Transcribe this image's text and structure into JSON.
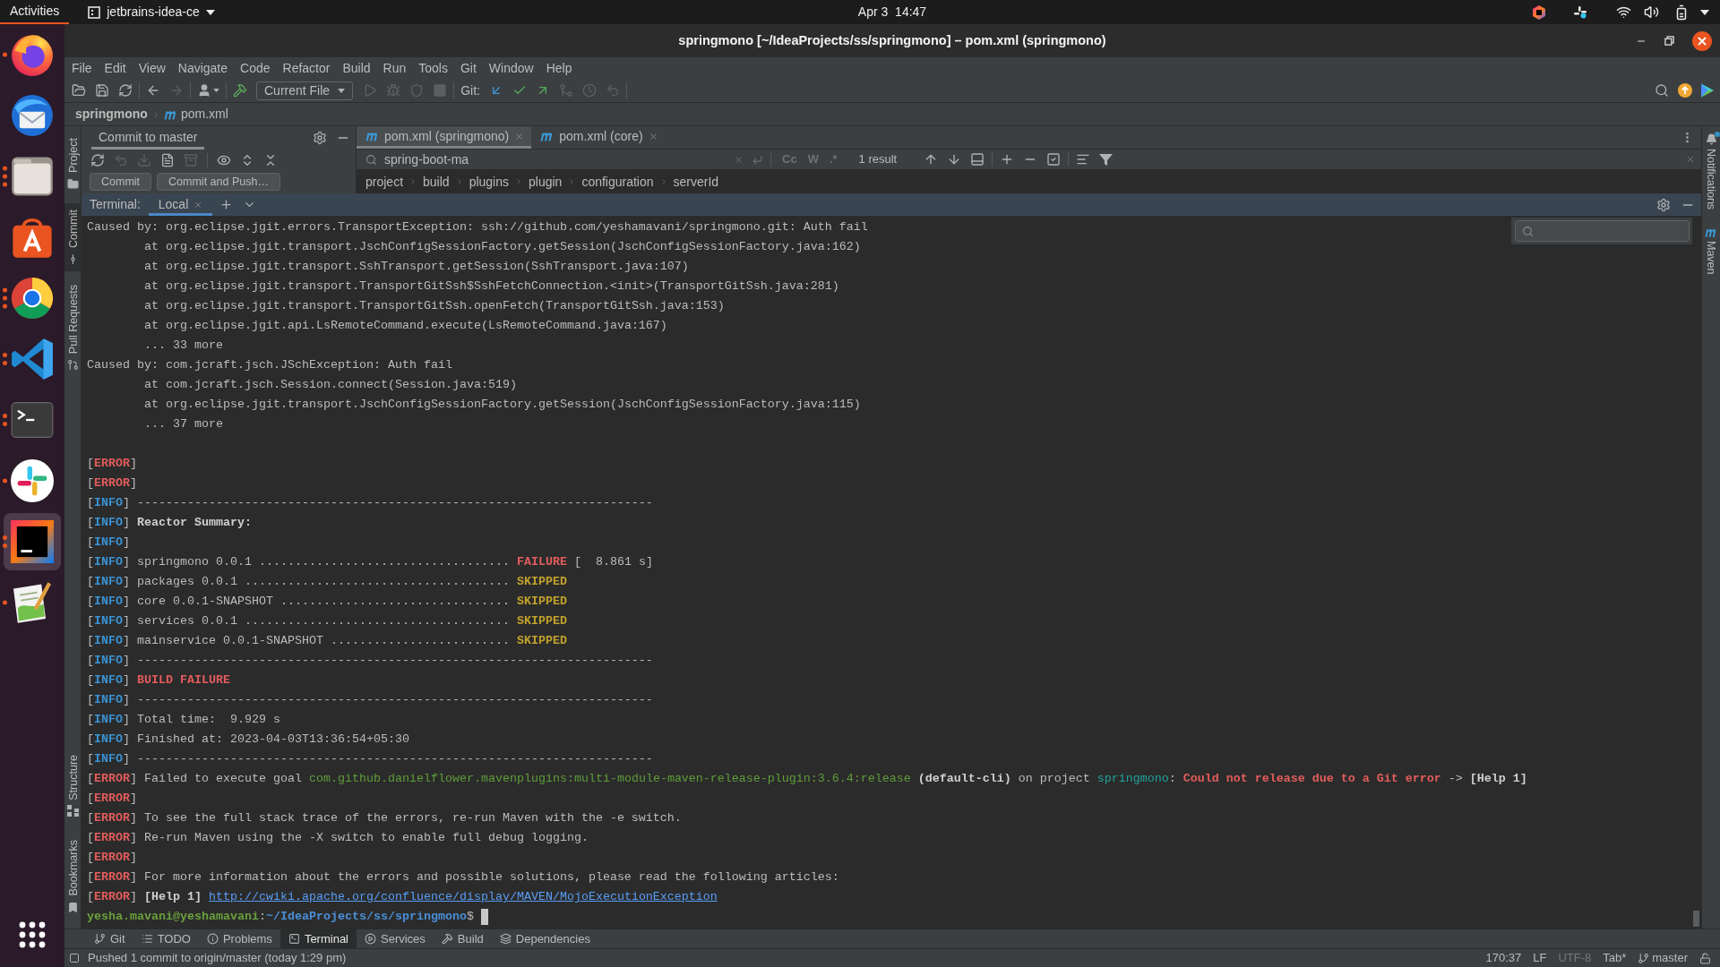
{
  "top_bar": {
    "activities": "Activities",
    "app_menu": "jetbrains-idea-ce",
    "clock": "Apr 3  14:47"
  },
  "dock": [
    {
      "kind": "browser",
      "selected": false,
      "windows": [
        {
          "kind": "dot"
        }
      ]
    },
    {
      "kind": "mail",
      "selected": false
    },
    {
      "kind": "files",
      "selected": false,
      "windows": [
        {
          "kind": "dot"
        },
        {
          "kind": "dot"
        },
        {
          "kind": "dot"
        }
      ]
    },
    {
      "kind": "store",
      "selected": false
    },
    {
      "kind": "web",
      "selected": false,
      "windows": [
        {
          "kind": "dot"
        },
        {
          "kind": "dot"
        },
        {
          "kind": "dot"
        }
      ]
    },
    {
      "kind": "editor",
      "selected": false,
      "windows": [
        {
          "kind": "dot"
        },
        {
          "kind": "dot"
        }
      ]
    },
    {
      "kind": "terminal",
      "selected": false,
      "windows": [
        {
          "kind": "dot"
        },
        {
          "kind": "dot"
        }
      ]
    },
    {
      "kind": "chat",
      "selected": false,
      "windows": [
        {
          "kind": "dot"
        }
      ]
    },
    {
      "kind": "ide",
      "selected": true,
      "windows": [
        {
          "kind": "dot"
        },
        {
          "kind": "dot"
        }
      ]
    },
    {
      "kind": "notepad",
      "selected": false,
      "windows": [
        {
          "kind": "dot"
        }
      ]
    }
  ],
  "window": {
    "title": "springmono [~/IdeaProjects/ss/springmono] – pom.xml (springmono)"
  },
  "menu": [
    "File",
    "Edit",
    "View",
    "Navigate",
    "Code",
    "Refactor",
    "Build",
    "Run",
    "Tools",
    "Git",
    "Window",
    "Help"
  ],
  "toolbar": {
    "nav_buttons": [
      {
        "disabled": false
      },
      {
        "disabled": true
      }
    ],
    "run_config": "Current File",
    "run_buttons": [
      {
        "disabled": true
      },
      {
        "disabled": true
      },
      {
        "disabled": true
      },
      {
        "disabled": true
      }
    ],
    "git_label": "Git:",
    "git_buttons": [
      {
        "disabled": false
      },
      {
        "disabled": false
      },
      {
        "disabled": false
      },
      {
        "disabled": true
      },
      {
        "disabled": true
      },
      {
        "disabled": true
      }
    ]
  },
  "navbar": {
    "project": "springmono",
    "file": "pom.xml"
  },
  "left_stripe": {
    "top": [
      {
        "kind": "project",
        "label": "Project",
        "selected": false
      },
      {
        "kind": "commit",
        "label": "Commit",
        "selected": true
      },
      {
        "kind": "pull_requests",
        "label": "Pull Requests",
        "selected": false
      }
    ],
    "bottom": [
      {
        "kind": "structure",
        "label": "Structure",
        "selected": false
      },
      {
        "kind": "bookmarks",
        "label": "Bookmarks",
        "selected": false
      }
    ]
  },
  "commit_panel": {
    "tab": "Commit to master",
    "tool_buttons": [
      {
        "disabled": false
      },
      {
        "disabled": true
      },
      {
        "disabled": true
      },
      {
        "disabled": false
      },
      {
        "disabled": true
      },
      {
        "disabled": false
      },
      {
        "disabled": false
      },
      {
        "disabled": false
      }
    ],
    "buttons": [
      "Commit",
      "Commit and Push…"
    ]
  },
  "editor": {
    "tabs": [
      {
        "label": "pom.xml (springmono)",
        "selected": true
      },
      {
        "label": "pom.xml (core)",
        "selected": false
      }
    ],
    "search": {
      "value": "spring-boot-ma",
      "options": [
        {
          "label": "Cc",
          "selected": false
        },
        {
          "label": "W",
          "selected": false
        },
        {
          "label": ".*",
          "selected": false
        }
      ],
      "result": "1 result"
    },
    "breadcrumbs": [
      "project",
      "build",
      "plugins",
      "plugin",
      "configuration",
      "serverId"
    ]
  },
  "terminal": {
    "label": "Terminal:",
    "tabs": [
      {
        "label": "Local",
        "selected": true
      }
    ],
    "lines": [
      {
        "kind": "log",
        "segments": [
          {
            "text": "Caused by: org.eclipse.jgit.errors.TransportException: ssh://github.com/yeshamavani/springmono.git: Auth fail",
            "kind": "plain"
          }
        ]
      },
      {
        "kind": "trace",
        "segments": [
          {
            "text": "at org.eclipse.jgit.transport.JschConfigSessionFactory.getSession(JschConfigSessionFactory.java:162)",
            "kind": "plain"
          }
        ]
      },
      {
        "kind": "trace",
        "segments": [
          {
            "text": "at org.eclipse.jgit.transport.SshTransport.getSession(SshTransport.java:107)",
            "kind": "plain"
          }
        ]
      },
      {
        "kind": "trace",
        "segments": [
          {
            "text": "at org.eclipse.jgit.transport.TransportGitSsh$SshFetchConnection.<init>(TransportGitSsh.java:281)",
            "kind": "plain"
          }
        ]
      },
      {
        "kind": "trace",
        "segments": [
          {
            "text": "at org.eclipse.jgit.transport.TransportGitSsh.openFetch(TransportGitSsh.java:153)",
            "kind": "plain"
          }
        ]
      },
      {
        "kind": "trace",
        "segments": [
          {
            "text": "at org.eclipse.jgit.api.LsRemoteCommand.execute(LsRemoteCommand.java:167)",
            "kind": "plain"
          }
        ]
      },
      {
        "kind": "trace",
        "segments": [
          {
            "text": "... 33 more",
            "kind": "plain"
          }
        ]
      },
      {
        "kind": "log",
        "segments": [
          {
            "text": "Caused by: com.jcraft.jsch.JSchException: Auth fail",
            "kind": "plain"
          }
        ]
      },
      {
        "kind": "trace",
        "segments": [
          {
            "text": "at com.jcraft.jsch.Session.connect(Session.java:519)",
            "kind": "plain"
          }
        ]
      },
      {
        "kind": "trace",
        "segments": [
          {
            "text": "at org.eclipse.jgit.transport.JschConfigSessionFactory.getSession(JschConfigSessionFactory.java:115)",
            "kind": "plain"
          }
        ]
      },
      {
        "kind": "trace",
        "segments": [
          {
            "text": "... 37 more",
            "kind": "plain"
          }
        ]
      },
      {
        "kind": "blank"
      },
      {
        "kind": "log",
        "segments": [
          {
            "text": "[",
            "kind": "plain"
          },
          {
            "text": "ERROR",
            "kind": "error"
          },
          {
            "text": "]",
            "kind": "plain"
          }
        ]
      },
      {
        "kind": "log",
        "segments": [
          {
            "text": "[",
            "kind": "plain"
          },
          {
            "text": "ERROR",
            "kind": "error"
          },
          {
            "text": "]",
            "kind": "plain"
          }
        ]
      },
      {
        "kind": "log",
        "segments": [
          {
            "text": "[",
            "kind": "plain"
          },
          {
            "text": "INFO",
            "kind": "info"
          },
          {
            "text": "] ------------------------------------------------------------------------",
            "kind": "plain"
          }
        ]
      },
      {
        "kind": "log",
        "segments": [
          {
            "text": "[",
            "kind": "plain"
          },
          {
            "text": "INFO",
            "kind": "info"
          },
          {
            "text": "] ",
            "kind": "plain"
          },
          {
            "text": "Reactor Summary:",
            "kind": "bold"
          }
        ]
      },
      {
        "kind": "log",
        "segments": [
          {
            "text": "[",
            "kind": "plain"
          },
          {
            "text": "INFO",
            "kind": "info"
          },
          {
            "text": "]",
            "kind": "plain"
          }
        ]
      },
      {
        "kind": "log",
        "segments": [
          {
            "text": "[",
            "kind": "plain"
          },
          {
            "text": "INFO",
            "kind": "info"
          },
          {
            "text": "] springmono 0.0.1 ................................... ",
            "kind": "plain"
          },
          {
            "text": "FAILURE",
            "kind": "error"
          },
          {
            "text": " [  8.861 s]",
            "kind": "plain"
          }
        ]
      },
      {
        "kind": "log",
        "segments": [
          {
            "text": "[",
            "kind": "plain"
          },
          {
            "text": "INFO",
            "kind": "info"
          },
          {
            "text": "] packages 0.0.1 ..................................... ",
            "kind": "plain"
          },
          {
            "text": "SKIPPED",
            "kind": "skipped"
          }
        ]
      },
      {
        "kind": "log",
        "segments": [
          {
            "text": "[",
            "kind": "plain"
          },
          {
            "text": "INFO",
            "kind": "info"
          },
          {
            "text": "] core 0.0.1-SNAPSHOT ................................ ",
            "kind": "plain"
          },
          {
            "text": "SKIPPED",
            "kind": "skipped"
          }
        ]
      },
      {
        "kind": "log",
        "segments": [
          {
            "text": "[",
            "kind": "plain"
          },
          {
            "text": "INFO",
            "kind": "info"
          },
          {
            "text": "] services 0.0.1 ..................................... ",
            "kind": "plain"
          },
          {
            "text": "SKIPPED",
            "kind": "skipped"
          }
        ]
      },
      {
        "kind": "log",
        "segments": [
          {
            "text": "[",
            "kind": "plain"
          },
          {
            "text": "INFO",
            "kind": "info"
          },
          {
            "text": "] mainservice 0.0.1-SNAPSHOT ......................... ",
            "kind": "plain"
          },
          {
            "text": "SKIPPED",
            "kind": "skipped"
          }
        ]
      },
      {
        "kind": "log",
        "segments": [
          {
            "text": "[",
            "kind": "plain"
          },
          {
            "text": "INFO",
            "kind": "info"
          },
          {
            "text": "] ------------------------------------------------------------------------",
            "kind": "plain"
          }
        ]
      },
      {
        "kind": "log",
        "segments": [
          {
            "text": "[",
            "kind": "plain"
          },
          {
            "text": "INFO",
            "kind": "info"
          },
          {
            "text": "] ",
            "kind": "plain"
          },
          {
            "text": "BUILD FAILURE",
            "kind": "error"
          }
        ]
      },
      {
        "kind": "log",
        "segments": [
          {
            "text": "[",
            "kind": "plain"
          },
          {
            "text": "INFO",
            "kind": "info"
          },
          {
            "text": "] ------------------------------------------------------------------------",
            "kind": "plain"
          }
        ]
      },
      {
        "kind": "log",
        "segments": [
          {
            "text": "[",
            "kind": "plain"
          },
          {
            "text": "INFO",
            "kind": "info"
          },
          {
            "text": "] Total time:  9.929 s",
            "kind": "plain"
          }
        ]
      },
      {
        "kind": "log",
        "segments": [
          {
            "text": "[",
            "kind": "plain"
          },
          {
            "text": "INFO",
            "kind": "info"
          },
          {
            "text": "] Finished at: 2023-04-03T13:36:54+05:30",
            "kind": "plain"
          }
        ]
      },
      {
        "kind": "log",
        "segments": [
          {
            "text": "[",
            "kind": "plain"
          },
          {
            "text": "INFO",
            "kind": "info"
          },
          {
            "text": "] ------------------------------------------------------------------------",
            "kind": "plain"
          }
        ]
      },
      {
        "kind": "log",
        "segments": [
          {
            "text": "[",
            "kind": "plain"
          },
          {
            "text": "ERROR",
            "kind": "error"
          },
          {
            "text": "] Failed to execute goal ",
            "kind": "plain"
          },
          {
            "text": "com.github.danielflower.mavenplugins:multi-module-maven-release-plugin:3.6.4:release",
            "kind": "green"
          },
          {
            "text": " (default-cli)",
            "kind": "bold"
          },
          {
            "text": " on project ",
            "kind": "plain"
          },
          {
            "text": "springmono",
            "kind": "teal"
          },
          {
            "text": ": ",
            "kind": "plain"
          },
          {
            "text": "Could not release due to a Git error",
            "kind": "error"
          },
          {
            "text": " -> ",
            "kind": "plain"
          },
          {
            "text": "[Help 1]",
            "kind": "bold"
          }
        ]
      },
      {
        "kind": "log",
        "segments": [
          {
            "text": "[",
            "kind": "plain"
          },
          {
            "text": "ERROR",
            "kind": "error"
          },
          {
            "text": "]",
            "kind": "plain"
          }
        ]
      },
      {
        "kind": "log",
        "segments": [
          {
            "text": "[",
            "kind": "plain"
          },
          {
            "text": "ERROR",
            "kind": "error"
          },
          {
            "text": "] To see the full stack trace of the errors, re-run Maven with the -e switch.",
            "kind": "plain"
          }
        ]
      },
      {
        "kind": "log",
        "segments": [
          {
            "text": "[",
            "kind": "plain"
          },
          {
            "text": "ERROR",
            "kind": "error"
          },
          {
            "text": "] Re-run Maven using the -X switch to enable full debug logging.",
            "kind": "plain"
          }
        ]
      },
      {
        "kind": "log",
        "segments": [
          {
            "text": "[",
            "kind": "plain"
          },
          {
            "text": "ERROR",
            "kind": "error"
          },
          {
            "text": "]",
            "kind": "plain"
          }
        ]
      },
      {
        "kind": "log",
        "segments": [
          {
            "text": "[",
            "kind": "plain"
          },
          {
            "text": "ERROR",
            "kind": "error"
          },
          {
            "text": "] For more information about the errors and possible solutions, please read the following articles:",
            "kind": "plain"
          }
        ]
      },
      {
        "kind": "log",
        "segments": [
          {
            "text": "[",
            "kind": "plain"
          },
          {
            "text": "ERROR",
            "kind": "error"
          },
          {
            "text": "] ",
            "kind": "plain"
          },
          {
            "text": "[Help 1] ",
            "kind": "bold"
          },
          {
            "text": "http://cwiki.apache.org/confluence/display/MAVEN/MojoExecutionException",
            "kind": "link"
          }
        ]
      }
    ],
    "prompt": {
      "segments": [
        {
          "text": "yesha.mavani@yeshamavani",
          "kind": "user"
        },
        {
          "text": ":",
          "kind": "plain"
        },
        {
          "text": "~/IdeaProjects/ss/springmono",
          "kind": "path"
        },
        {
          "text": "$",
          "kind": "plain"
        }
      ],
      "cursor": true
    }
  },
  "right_stripe": [
    {
      "kind": "notifications",
      "label": "Notifications",
      "unread": true
    },
    {
      "kind": "maven",
      "label": "Maven",
      "unread": false
    }
  ],
  "bottom_bar": [
    {
      "kind": "git",
      "label": "Git",
      "selected": false
    },
    {
      "kind": "todo",
      "label": "TODO",
      "selected": false
    },
    {
      "kind": "problems",
      "label": "Problems",
      "selected": false
    },
    {
      "kind": "terminal",
      "label": "Terminal",
      "selected": true
    },
    {
      "kind": "services",
      "label": "Services",
      "selected": false
    },
    {
      "kind": "build",
      "label": "Build",
      "selected": false
    },
    {
      "kind": "dependencies",
      "label": "Dependencies",
      "selected": false
    }
  ],
  "status_bar": {
    "message": "Pushed 1 commit to origin/master (today 1:29 pm)",
    "position": "170:37",
    "line_separator": "LF",
    "encoding": {
      "text": "UTF-8",
      "disabled": true
    },
    "indent": "Tab*",
    "branch": "master"
  }
}
